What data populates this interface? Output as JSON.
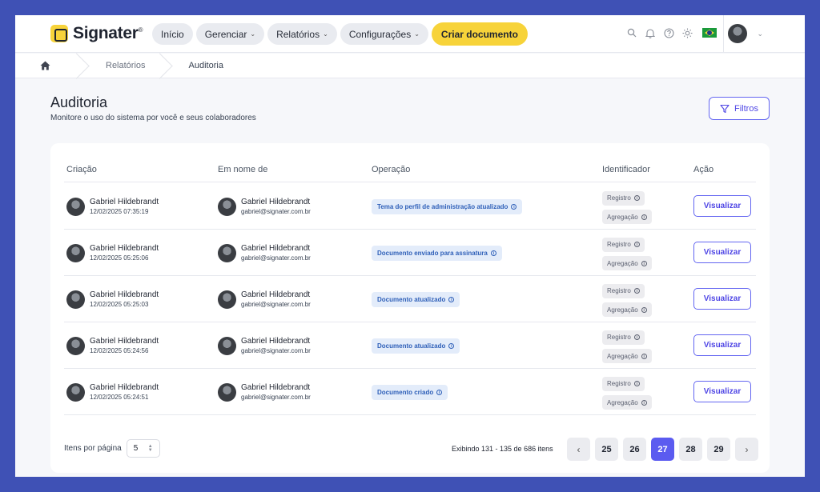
{
  "app": {
    "brand": "Signater",
    "brand_reg": "®"
  },
  "nav": {
    "items": [
      {
        "label": "Início",
        "dropdown": false
      },
      {
        "label": "Gerenciar",
        "dropdown": true
      },
      {
        "label": "Relatórios",
        "dropdown": true
      },
      {
        "label": "Configurações",
        "dropdown": true
      }
    ],
    "cta_label": "Criar documento"
  },
  "topbar_icons": [
    "search-icon",
    "bell-icon",
    "help-icon",
    "sun-icon",
    "brazil-flag-icon"
  ],
  "breadcrumb": {
    "items": [
      "Relatórios",
      "Auditoria"
    ]
  },
  "page": {
    "title": "Auditoria",
    "subtitle": "Monitore o uso do sistema por você e seus colaboradores",
    "filters_label": "Filtros"
  },
  "table": {
    "columns": [
      "Criação",
      "Em nome de",
      "Operação",
      "Identificador",
      "Ação"
    ],
    "rows": [
      {
        "creator": "Gabriel Hildebrandt",
        "date": "12/02/2025 07:35:19",
        "on_behalf": "Gabriel Hildebrandt",
        "email": "gabriel@signater.com.br",
        "operation": "Tema do perfil de administração atualizado",
        "ids": [
          "Registro",
          "Agregação"
        ],
        "action": "Visualizar"
      },
      {
        "creator": "Gabriel Hildebrandt",
        "date": "12/02/2025 05:25:06",
        "on_behalf": "Gabriel Hildebrandt",
        "email": "gabriel@signater.com.br",
        "operation": "Documento enviado para assinatura",
        "ids": [
          "Registro",
          "Agregação"
        ],
        "action": "Visualizar"
      },
      {
        "creator": "Gabriel Hildebrandt",
        "date": "12/02/2025 05:25:03",
        "on_behalf": "Gabriel Hildebrandt",
        "email": "gabriel@signater.com.br",
        "operation": "Documento atualizado",
        "ids": [
          "Registro",
          "Agregação"
        ],
        "action": "Visualizar"
      },
      {
        "creator": "Gabriel Hildebrandt",
        "date": "12/02/2025 05:24:56",
        "on_behalf": "Gabriel Hildebrandt",
        "email": "gabriel@signater.com.br",
        "operation": "Documento atualizado",
        "ids": [
          "Registro",
          "Agregação"
        ],
        "action": "Visualizar"
      },
      {
        "creator": "Gabriel Hildebrandt",
        "date": "12/02/2025 05:24:51",
        "on_behalf": "Gabriel Hildebrandt",
        "email": "gabriel@signater.com.br",
        "operation": "Documento criado",
        "ids": [
          "Registro",
          "Agregação"
        ],
        "action": "Visualizar"
      }
    ]
  },
  "pagination": {
    "per_page_label": "Itens por página",
    "per_page_value": "5",
    "showing": "Exibindo 131 - 135 de 686 itens",
    "pages": [
      "25",
      "26",
      "27",
      "28",
      "29"
    ],
    "current_page": "27"
  },
  "colors": {
    "accent": "#5b5bf0",
    "cta": "#f7d33a",
    "background": "#3f51b5"
  }
}
